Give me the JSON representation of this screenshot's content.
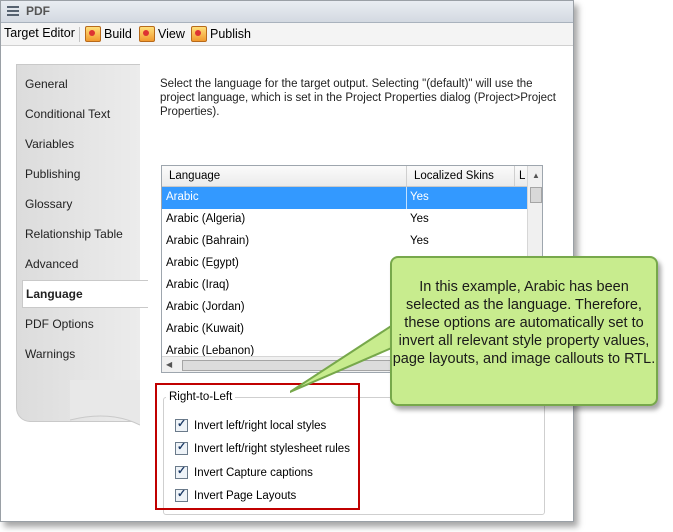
{
  "window": {
    "title": "PDF"
  },
  "toolbar": {
    "editor_label": "Target Editor",
    "build_label": "Build",
    "view_label": "View",
    "publish_label": "Publish"
  },
  "tabs": [
    {
      "label": "General"
    },
    {
      "label": "Conditional Text"
    },
    {
      "label": "Variables"
    },
    {
      "label": "Publishing"
    },
    {
      "label": "Glossary"
    },
    {
      "label": "Relationship Table"
    },
    {
      "label": "Advanced"
    },
    {
      "label": "Language"
    },
    {
      "label": "PDF Options"
    },
    {
      "label": "Warnings"
    }
  ],
  "description": "Select the language for the target output. Selecting \"(default)\" will use the project language, which is set in the Project Properties dialog (Project>Project Properties).",
  "table": {
    "columns": [
      "Language",
      "Localized Skins",
      "L"
    ],
    "rows": [
      {
        "language": "Arabic",
        "skins": "Yes"
      },
      {
        "language": "Arabic (Algeria)",
        "skins": "Yes"
      },
      {
        "language": "Arabic (Bahrain)",
        "skins": "Yes"
      },
      {
        "language": "Arabic (Egypt)",
        "skins": ""
      },
      {
        "language": "Arabic (Iraq)",
        "skins": ""
      },
      {
        "language": "Arabic (Jordan)",
        "skins": ""
      },
      {
        "language": "Arabic (Kuwait)",
        "skins": ""
      },
      {
        "language": "Arabic (Lebanon)",
        "skins": ""
      }
    ]
  },
  "rtl": {
    "title": "Right-to-Left",
    "options": [
      {
        "label": "Invert left/right local styles",
        "checked": true
      },
      {
        "label": "Invert left/right stylesheet rules",
        "checked": true
      },
      {
        "label": "Invert Capture captions",
        "checked": true
      },
      {
        "label": "Invert Page Layouts",
        "checked": true
      }
    ]
  },
  "callout": {
    "text": "In this example, Arabic has been selected as the language. Therefore, these options are automatically set to invert all relevant style property values, page layouts, and image callouts to RTL."
  },
  "colors": {
    "selection": "#3399ff",
    "highlight_box": "#c00000",
    "callout_fill": "#c8ec8e",
    "callout_border": "#77a84b"
  }
}
